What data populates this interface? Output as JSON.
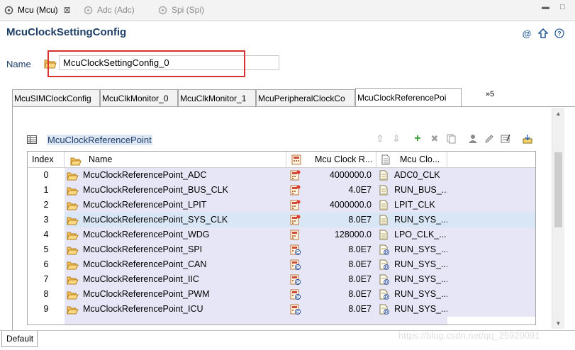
{
  "editor_tabs": [
    {
      "label": "Mcu (Mcu)",
      "active": true,
      "close": "⊠"
    },
    {
      "label": "Adc (Adc)",
      "active": false
    },
    {
      "label": "Spi (Spi)",
      "active": false
    }
  ],
  "page_title": "McuClockSettingConfig",
  "name_field": {
    "label": "Name",
    "value": "McuClockSettingConfig_0"
  },
  "inner_tabs": [
    {
      "label": "McuSIMClockConfig"
    },
    {
      "label": "McuClkMonitor_0"
    },
    {
      "label": "McuClkMonitor_1"
    },
    {
      "label": "McuPeripheralClockCo"
    },
    {
      "label": "McuClockReferencePoi"
    }
  ],
  "inner_tabs_more": "»5",
  "section_title": "McuClockReferencePoint",
  "table": {
    "headers": {
      "index": "Index",
      "name": "Name",
      "freq": "Mcu Clock R...",
      "ref": "Mcu Clo..."
    },
    "rows": [
      {
        "index": "0",
        "name": "McuClockReferencePoint_ADC",
        "freq": "4000000.0",
        "ref": "ADC0_CLK",
        "freq_icon": "calc-icon",
        "ref_icon": "doc-icon"
      },
      {
        "index": "1",
        "name": "McuClockReferencePoint_BUS_CLK",
        "freq": "4.0E7",
        "ref": "RUN_BUS_...",
        "freq_icon": "calc-icon",
        "ref_icon": "doc-icon"
      },
      {
        "index": "2",
        "name": "McuClockReferencePoint_LPIT",
        "freq": "4000000.0",
        "ref": "LPIT_CLK",
        "freq_icon": "calc-icon",
        "ref_icon": "doc-icon"
      },
      {
        "index": "3",
        "name": "McuClockReferencePoint_SYS_CLK",
        "freq": "8.0E7",
        "ref": "RUN_SYS_...",
        "freq_icon": "calc-icon",
        "ref_icon": "doc-icon",
        "selected": true
      },
      {
        "index": "4",
        "name": "McuClockReferencePoint_WDG",
        "freq": "128000.0",
        "ref": "LPO_CLK_...",
        "freq_icon": "calc-plain-icon",
        "ref_icon": "doc-icon"
      },
      {
        "index": "5",
        "name": "McuClockReferencePoint_SPI",
        "freq": "8.0E7",
        "ref": "RUN_SYS_...",
        "freq_icon": "calc-c-icon",
        "ref_icon": "doc-d-icon"
      },
      {
        "index": "6",
        "name": "McuClockReferencePoint_CAN",
        "freq": "8.0E7",
        "ref": "RUN_SYS_...",
        "freq_icon": "calc-c-icon",
        "ref_icon": "doc-d-icon"
      },
      {
        "index": "7",
        "name": "McuClockReferencePoint_IIC",
        "freq": "8.0E7",
        "ref": "RUN_SYS_...",
        "freq_icon": "calc-c-icon",
        "ref_icon": "doc-d-icon"
      },
      {
        "index": "8",
        "name": "McuClockReferencePoint_PWM",
        "freq": "8.0E7",
        "ref": "RUN_SYS_...",
        "freq_icon": "calc-c-icon",
        "ref_icon": "doc-d-icon"
      },
      {
        "index": "9",
        "name": "McuClockReferencePoint_ICU",
        "freq": "8.0E7",
        "ref": "RUN_SYS_...",
        "freq_icon": "calc-c-icon",
        "ref_icon": "doc-d-icon"
      }
    ]
  },
  "bottom_tab": "Default",
  "watermark": "https://blog.csdn.net/qq_25920091",
  "colors": {
    "title": "#1f3f67",
    "row_bg": "#e6e6f7",
    "highlight": "#d93030",
    "section_bg": "#dce6f4"
  }
}
